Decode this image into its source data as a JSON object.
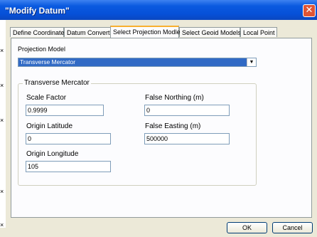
{
  "window": {
    "title": "\"Modify Datum\""
  },
  "tabs": [
    {
      "label": "Define Coordinate"
    },
    {
      "label": "Datum Convert"
    },
    {
      "label": "Select Projection Modle"
    },
    {
      "label": "Select Geoid Models"
    },
    {
      "label": "Local Point"
    }
  ],
  "projection": {
    "model_label": "Projection Model",
    "model_value": "Transverse Mercator"
  },
  "group": {
    "legend": "Transverse Mercator",
    "scale_factor": {
      "label": "Scale Factor",
      "value": "0.9999"
    },
    "origin_latitude": {
      "label": "Origin Latitude",
      "value": "0"
    },
    "origin_longitude": {
      "label": "Origin Longitude",
      "value": "105"
    },
    "false_northing": {
      "label": "False Northing (m)",
      "value": "0"
    },
    "false_easting": {
      "label": "False Easting (m)",
      "value": "500000"
    }
  },
  "buttons": {
    "ok": "OK",
    "cancel": "Cancel"
  }
}
